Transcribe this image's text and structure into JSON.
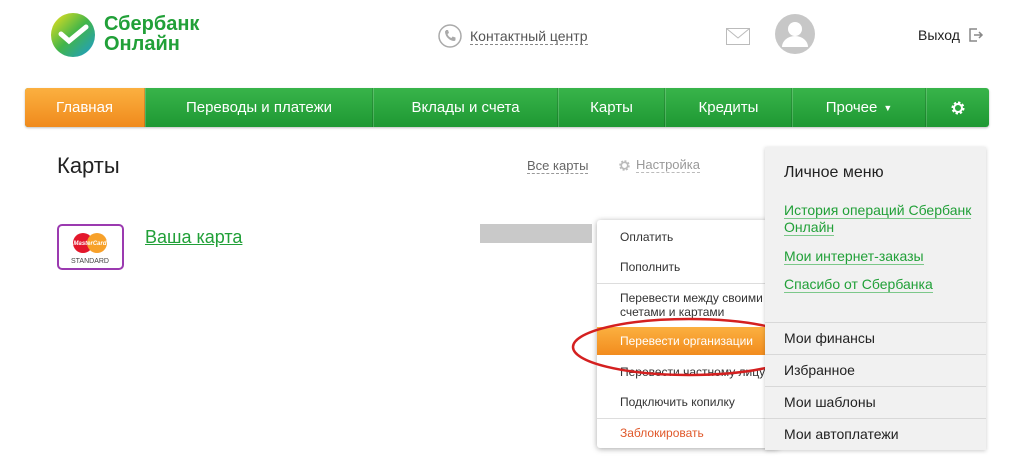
{
  "brand": {
    "line1": "Сбербанк",
    "line2": "Онлайн",
    "color": "#21a038"
  },
  "header": {
    "contact_label": "Контактный центр",
    "logout_label": "Выход"
  },
  "nav": {
    "items": [
      {
        "label": "Главная",
        "active": true
      },
      {
        "label": "Переводы и платежи"
      },
      {
        "label": "Вклады и счета"
      },
      {
        "label": "Карты"
      },
      {
        "label": "Кредиты"
      },
      {
        "label": "Прочее"
      }
    ],
    "accent": "#f7a031"
  },
  "page": {
    "title": "Карты",
    "all_cards": "Все карты",
    "settings": "Настройка"
  },
  "card": {
    "brand_badge": "STANDARD",
    "brand_logo_text": "MasterCard",
    "link": "Ваша карта"
  },
  "dropdown": {
    "items": [
      {
        "label": "Оплатить"
      },
      {
        "label": "Пополнить"
      },
      {
        "label": "Перевести между своими счетами и картами"
      },
      {
        "label": "Перевести организации",
        "highlighted": true
      },
      {
        "label": "Перевести частному лицу"
      },
      {
        "label": "Подключить копилку"
      },
      {
        "label": "Заблокировать",
        "danger": true
      }
    ]
  },
  "personal_menu": {
    "title": "Личное меню",
    "links": [
      {
        "label": "История операций Сбербанк Онлайн"
      },
      {
        "label": "Мои интернет-заказы"
      },
      {
        "label": "Спасибо от Сбербанка"
      }
    ],
    "sections": [
      {
        "label": "Мои финансы"
      },
      {
        "label": "Избранное"
      },
      {
        "label": "Мои шаблоны"
      },
      {
        "label": "Мои автоплатежи"
      }
    ]
  }
}
